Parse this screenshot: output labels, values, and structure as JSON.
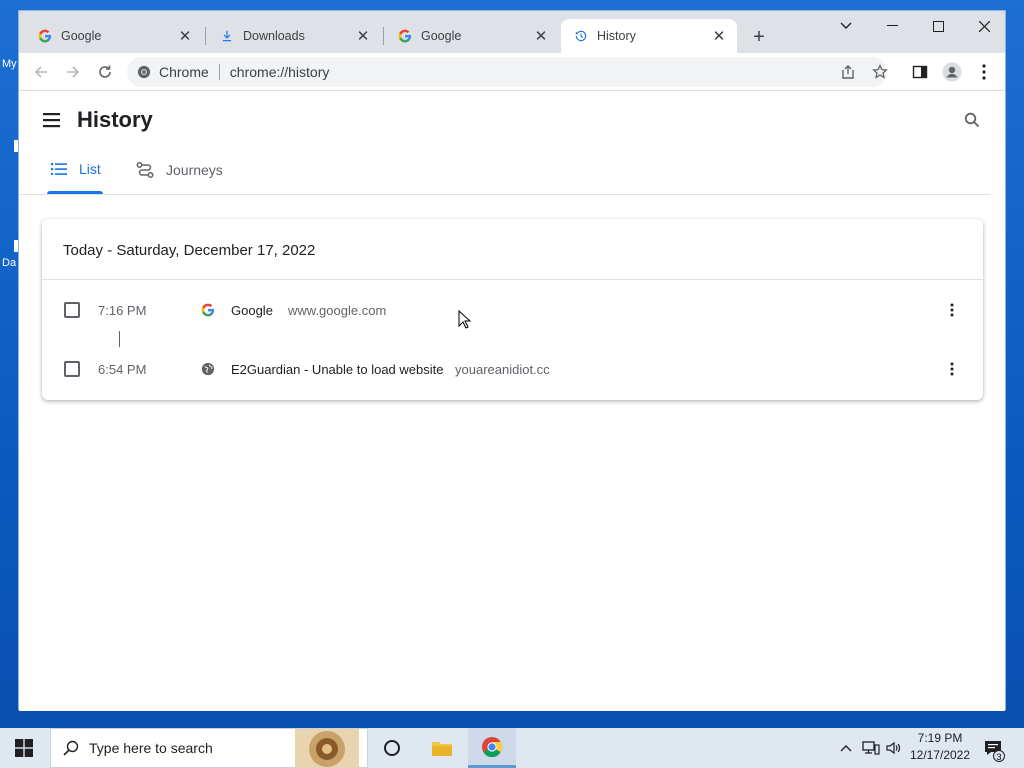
{
  "desktop": {
    "icon_label_1": "My",
    "icon_label_2": "Da"
  },
  "browser": {
    "tabs": [
      {
        "title": "Google",
        "icon": "google-g-icon"
      },
      {
        "title": "Downloads",
        "icon": "download-icon"
      },
      {
        "title": "Google",
        "icon": "google-g-icon"
      },
      {
        "title": "History",
        "icon": "history-icon",
        "active": true
      }
    ],
    "omnibox": {
      "chip": "Chrome",
      "url": "chrome://history"
    }
  },
  "history": {
    "title": "History",
    "tabs": [
      {
        "label": "List",
        "active": true
      },
      {
        "label": "Journeys",
        "active": false
      }
    ],
    "day_heading": "Today - Saturday, December 17, 2022",
    "entries": [
      {
        "time": "7:16 PM",
        "title": "Google",
        "domain": "www.google.com",
        "favicon": "google-g-icon"
      },
      {
        "time": "6:54 PM",
        "title": "E2Guardian - Unable to load website",
        "domain": "youareanidiot.cc",
        "favicon": "globe-icon"
      }
    ]
  },
  "taskbar": {
    "search_placeholder": "Type here to search",
    "clock_time": "7:19 PM",
    "clock_date": "12/17/2022",
    "notification_count": "3"
  },
  "colors": {
    "accent": "#1a73e8",
    "desktop": "#0b5bc0",
    "tabstrip": "#dee1e6"
  }
}
